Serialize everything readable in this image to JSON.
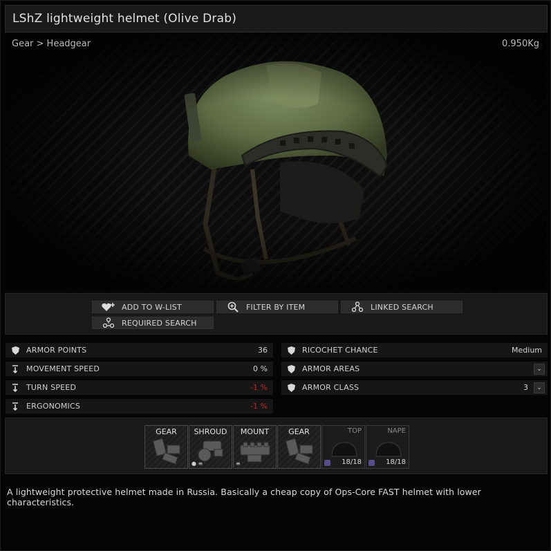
{
  "window": {
    "title": "LShZ lightweight helmet (Olive Drab)",
    "breadcrumb": "Gear > Headgear",
    "weight": "0.950Kg"
  },
  "actions": [
    {
      "label": "ADD TO W-LIST",
      "icon": "heart-plus-icon"
    },
    {
      "label": "FILTER BY ITEM",
      "icon": "magnifier-plus-icon"
    },
    {
      "label": "LINKED SEARCH",
      "icon": "linked-nodes-icon"
    },
    {
      "label": "REQUIRED SEARCH",
      "icon": "required-nodes-icon"
    }
  ],
  "stats_left": [
    {
      "label": "ARMOR POINTS",
      "value": "36",
      "icon": "shield-icon"
    },
    {
      "label": "MOVEMENT SPEED",
      "value": "0 %",
      "icon": "stat-arrow-icon"
    },
    {
      "label": "TURN SPEED",
      "value": "-1 %",
      "icon": "stat-arrow-icon",
      "negative": true
    },
    {
      "label": "ERGONOMICS",
      "value": "-1 %",
      "icon": "stat-arrow-icon",
      "negative": true
    }
  ],
  "stats_right": [
    {
      "label": "RICOCHET CHANCE",
      "value": "Medium",
      "icon": "shield-icon"
    },
    {
      "label": "ARMOR AREAS",
      "value": "",
      "icon": "shield-icon",
      "dropdown": true
    },
    {
      "label": "ARMOR CLASS",
      "value": "3",
      "icon": "shield-icon",
      "dropdown": true
    }
  ],
  "slots": [
    {
      "name": "GEAR",
      "type": "gear"
    },
    {
      "name": "SHROUD",
      "type": "shroud"
    },
    {
      "name": "MOUNT",
      "type": "mount"
    },
    {
      "name": "GEAR",
      "type": "gear"
    },
    {
      "name": "TOP",
      "type": "armor",
      "durability": "18/18"
    },
    {
      "name": "NAPE",
      "type": "armor",
      "durability": "18/18"
    }
  ],
  "description": "A lightweight protective helmet made in Russia. Basically a cheap copy of Ops-Core FAST helmet with lower characteristics.",
  "colors": {
    "negative": "#c62727",
    "helmet": "#6b7a4f",
    "armor_plate_icon": "#5a4c8a"
  }
}
